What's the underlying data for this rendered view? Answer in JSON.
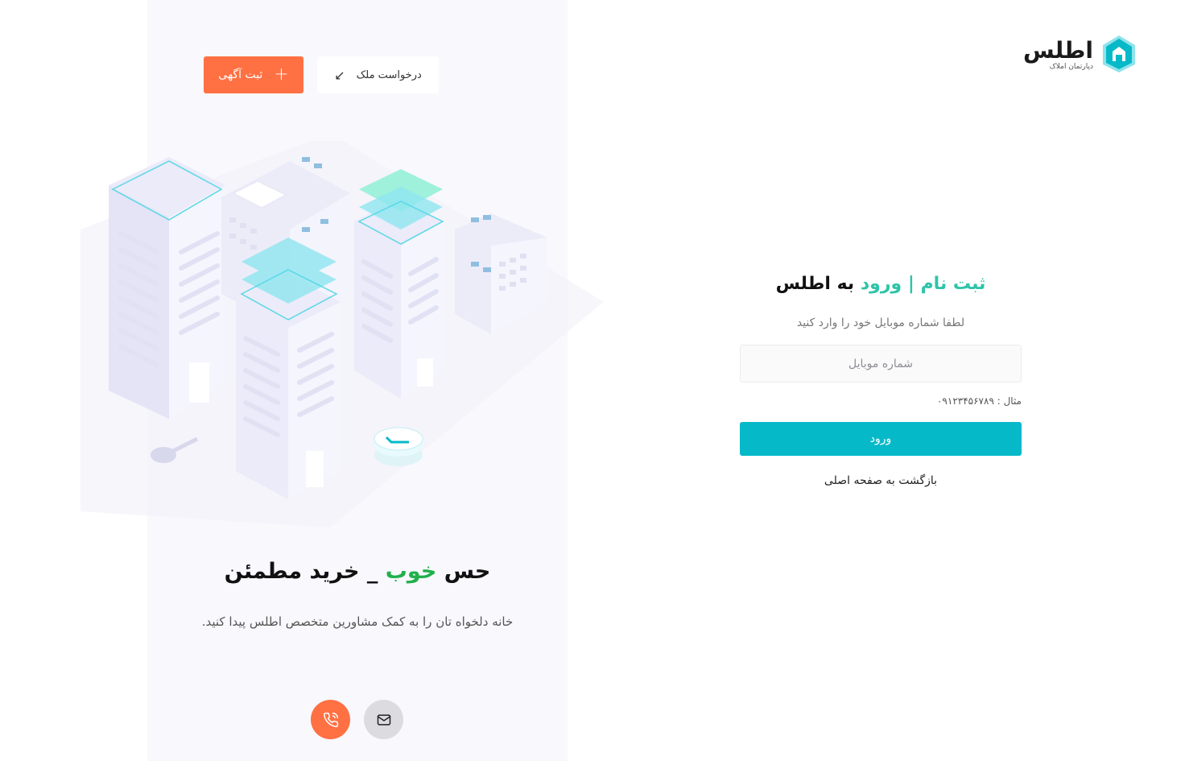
{
  "header": {
    "post_ad_label": "ثبت آگهی",
    "request_property_label": "درخواست ملک"
  },
  "hero": {
    "slogan_part1": "حس",
    "slogan_highlight": "خوب",
    "slogan_part2": "_ خرید مطمئن",
    "subtitle": "خانه دلخواه تان را به کمک مشاورین متخصص اطلس پیدا کنید."
  },
  "brand": {
    "name": "اطلس",
    "tagline": "دپارتمان املاک",
    "accent_color": "#06b9c9",
    "orange_color": "#ff7043",
    "green_color": "#22b04b"
  },
  "form": {
    "title_register": "ثبت نام",
    "title_separator": "|",
    "title_login": "ورود",
    "title_suffix": "به اطلس",
    "hint": "لطفا شماره موبایل خود را وارد کنید",
    "mobile_placeholder": "شماره موبایل",
    "mobile_value": "",
    "example_text": "مثال : ۰۹۱۲۳۴۵۶۷۸۹",
    "submit_label": "ورود",
    "back_label": "بازگشت به صفحه اصلی"
  },
  "contact": {
    "phone_icon": "phone-icon",
    "mail_icon": "mail-icon"
  }
}
